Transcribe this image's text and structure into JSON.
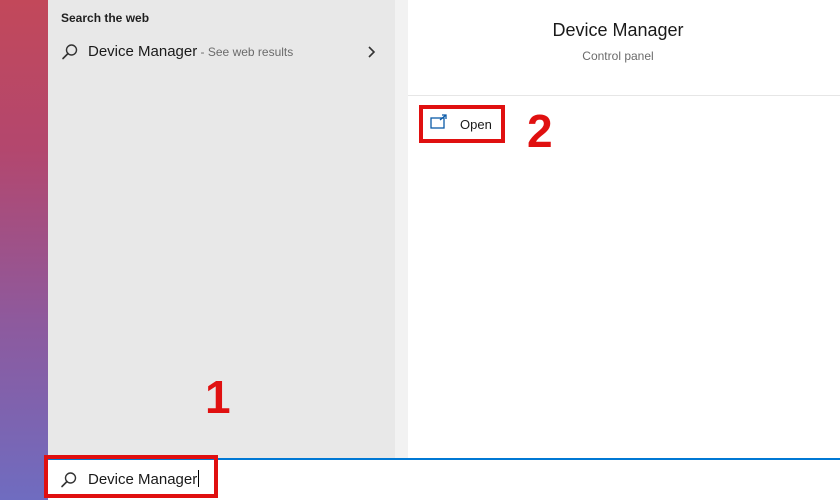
{
  "search_results": {
    "section_header": "Search the web",
    "web_result": {
      "title": "Device Manager",
      "subtitle": " - See web results",
      "icon": "search-icon"
    }
  },
  "preview": {
    "title": "Device Manager",
    "subtitle": "Control panel",
    "actions": [
      {
        "label": "Open",
        "icon": "open-window-icon"
      }
    ]
  },
  "taskbar_search": {
    "value": "Device Manager",
    "icon": "search-icon"
  },
  "annotations": {
    "step1": "1",
    "step2": "2",
    "color": "#e01010"
  },
  "colors": {
    "accent": "#0078d4",
    "left_pane_bg": "#e8e8e8"
  }
}
